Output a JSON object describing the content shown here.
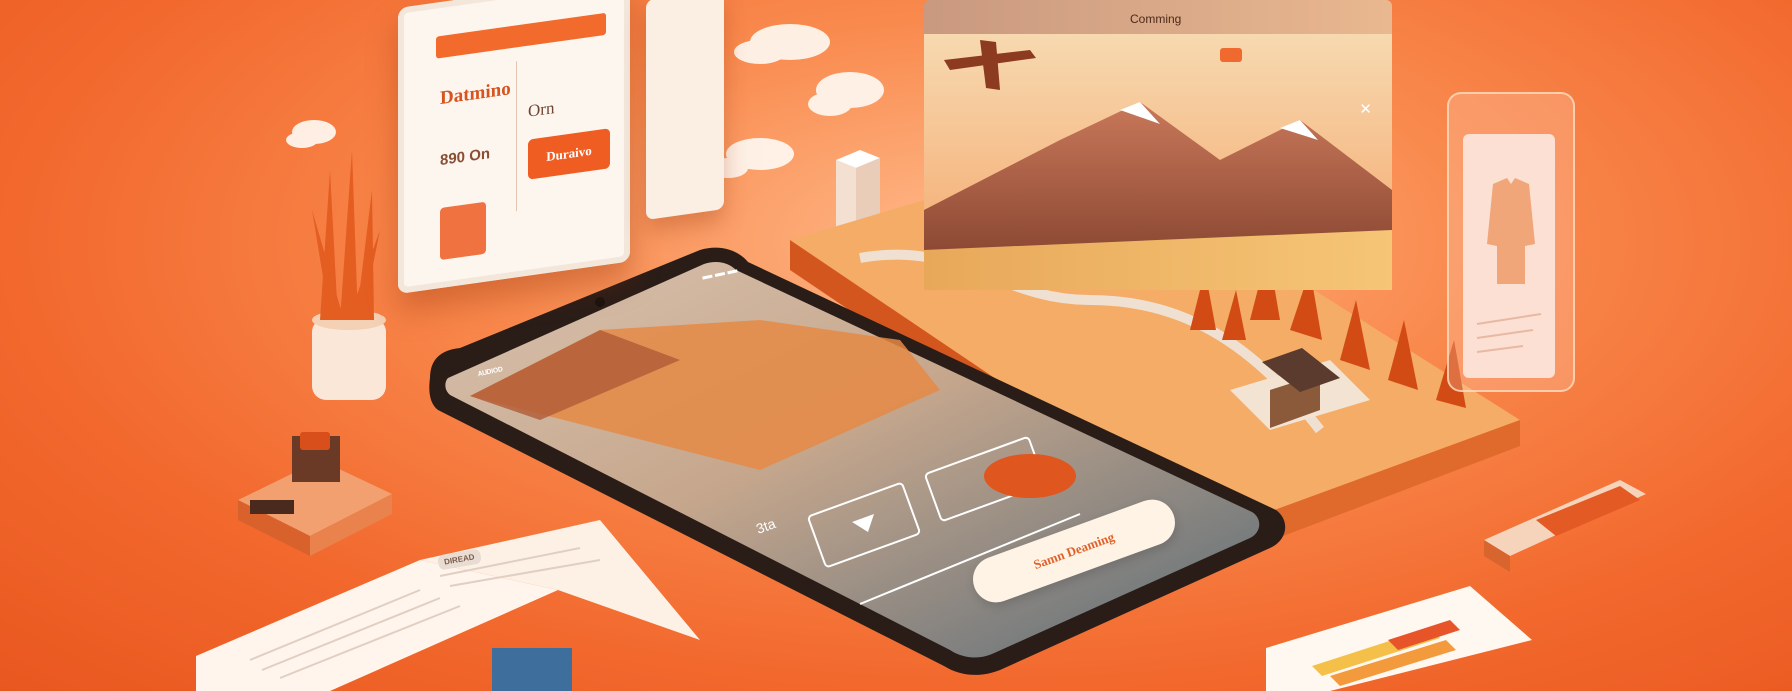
{
  "scene": {
    "background_color": "#f2682d",
    "accent_color": "#ef5d22"
  },
  "form_card": {
    "title": "Datmino",
    "field_label": "Orn",
    "price": "890 On",
    "button_label": "Duraivo"
  },
  "scenic_panel": {
    "nav_label": "Comming",
    "close_icon": "close-icon"
  },
  "phone": {
    "ui_label": "ᴬᵁᴰᴵᴼᴰ",
    "status": "▬ ▬ ▬",
    "side_text": "3ta",
    "cta_label": "Samn Deaming",
    "play_icon": "play-icon"
  },
  "book": {
    "tag": "DIREAD"
  }
}
